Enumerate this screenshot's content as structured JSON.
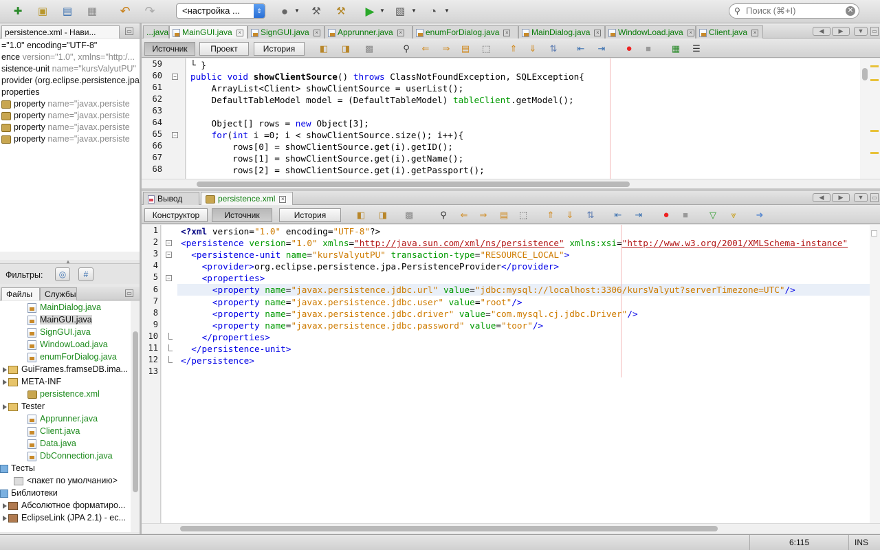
{
  "toolbar": {
    "config_select": "<настройка ...",
    "search_placeholder": "Поиск (⌘+I)"
  },
  "navigator": {
    "tab_label": "persistence.xml - Нави...",
    "lines": [
      {
        "text": "=\"1.0\" encoding=\"UTF-8\"",
        "attr": ""
      },
      {
        "text": "ence",
        "attr": " version=\"1.0\", xmlns=\"http:/..."
      },
      {
        "text": "sistence-unit",
        "attr": " name=\"kursValyutPU\""
      },
      {
        "text": "provider (org.eclipse.persistence.jpa...",
        "attr": ""
      },
      {
        "text": "properties",
        "attr": ""
      },
      {
        "text": "property",
        "attr": " name=\"javax.persiste"
      },
      {
        "text": "property",
        "attr": " name=\"javax.persiste"
      },
      {
        "text": "property",
        "attr": " name=\"javax.persiste"
      },
      {
        "text": "property",
        "attr": " name=\"javax.persiste"
      }
    ],
    "filters_label": "Фильтры:"
  },
  "project": {
    "tabs": [
      "Файлы",
      "Службы"
    ],
    "items": [
      {
        "label": "MainDialog.java",
        "indent": 40,
        "type": "java"
      },
      {
        "label": "MainGUI.java",
        "indent": 40,
        "type": "java-selected"
      },
      {
        "label": "SignGUI.java",
        "indent": 40,
        "type": "java"
      },
      {
        "label": "WindowLoad.java",
        "indent": 40,
        "type": "java"
      },
      {
        "label": "enumForDialog.java",
        "indent": 40,
        "type": "java"
      },
      {
        "label": "GuiFrames.framseDB.ima...",
        "indent": 4,
        "type": "pkg"
      },
      {
        "label": "META-INF",
        "indent": 4,
        "type": "pkg"
      },
      {
        "label": "persistence.xml",
        "indent": 40,
        "type": "xml"
      },
      {
        "label": "Tester",
        "indent": 4,
        "type": "pkg"
      },
      {
        "label": "Apprunner.java",
        "indent": 40,
        "type": "java"
      },
      {
        "label": "Client.java",
        "indent": 40,
        "type": "java"
      },
      {
        "label": "Data.java",
        "indent": 40,
        "type": "java"
      },
      {
        "label": "DbConnection.java",
        "indent": 40,
        "type": "java"
      },
      {
        "label": "Тесты",
        "indent": 0,
        "type": "folder"
      },
      {
        "label": "<пакет по умолчанию>",
        "indent": 20,
        "type": "pkgdef"
      },
      {
        "label": "Библиотеки",
        "indent": 0,
        "type": "folder"
      },
      {
        "label": "Абсолютное форматиро...",
        "indent": 4,
        "type": "lib"
      },
      {
        "label": "EclipseLink (JPA 2.1) - ec...",
        "indent": 4,
        "type": "lib"
      }
    ]
  },
  "top_editor": {
    "tabs": [
      "...java",
      "MainGUI.java",
      "SignGUI.java",
      "Apprunner.java",
      "enumForDialog.java",
      "MainDialog.java",
      "WindowLoad.java",
      "Client.java"
    ],
    "active_tab": 1,
    "toolbar": {
      "source": "Источник",
      "project": "Проект",
      "history": "История"
    },
    "line_start": 59,
    "line_numbers": [
      "59",
      "60",
      "61",
      "62",
      "63",
      "64",
      "65",
      "66",
      "67",
      "68"
    ]
  },
  "bottom_editor": {
    "tabs": [
      "Вывод",
      "persistence.xml"
    ],
    "toolbar": {
      "designer": "Конструктор",
      "source": "Источник",
      "history": "История"
    },
    "line_numbers": [
      "1",
      "2",
      "3",
      "4",
      "5",
      "6",
      "7",
      "8",
      "9",
      "10",
      "11",
      "12",
      "13"
    ]
  },
  "status": {
    "position": "6:115",
    "mode": "INS"
  },
  "colors": {
    "keyword": "#0000e6",
    "string": "#ce7b00",
    "attribute": "#009900"
  }
}
